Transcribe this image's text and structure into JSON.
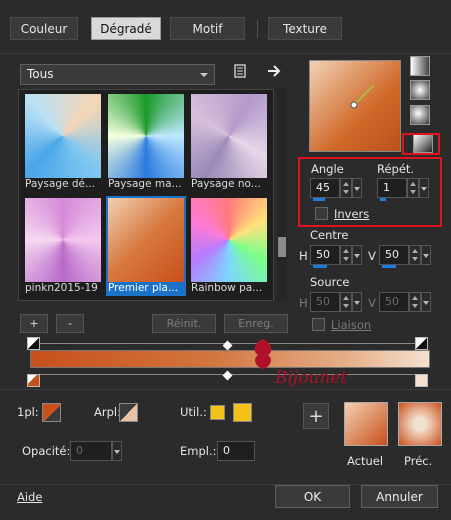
{
  "tabs": [
    "Couleur",
    "Dégradé",
    "Motif",
    "Texture"
  ],
  "active_tab": "Dégradé",
  "category_select": "Tous",
  "gallery": [
    {
      "caption": "Paysage dé..."
    },
    {
      "caption": "Paysage ma..."
    },
    {
      "caption": "Paysage no..."
    },
    {
      "caption": "pinkn2015-19"
    },
    {
      "caption": "Premier pla..."
    },
    {
      "caption": "Rainbow pa..."
    }
  ],
  "buttons": {
    "add": "+",
    "remove": "-",
    "reset": "Réinit.",
    "save": "Enreg.",
    "ok": "OK",
    "cancel": "Annuler",
    "help": "Aide",
    "add_swatch": "+"
  },
  "gradient": {
    "angle_label": "Angle",
    "angle_value": "45",
    "repeat_label": "Répét.",
    "repeat_value": "1",
    "invert_label": "Invers",
    "center_label": "Centre",
    "center_h_label": "H",
    "center_h": "50",
    "center_v_label": "V",
    "center_v": "50",
    "source_label": "Source",
    "source_h_label": "H",
    "source_h": "50",
    "source_v_label": "V",
    "source_v": "50",
    "link_label": "Liaison"
  },
  "editor": {
    "fg_label": "1pl:",
    "bg_label": "Arpl:",
    "user_label": "Util.:",
    "opacity_label": "Opacité:",
    "opacity_value": "0",
    "position_label": "Empl.:",
    "position_value": "0",
    "current_label": "Actuel",
    "previous_label": "Préc.",
    "watermark": "Bijounet"
  },
  "colors": {
    "accent": "#1a73c9",
    "highlight_box": "#e0141e",
    "gradient_start": "#c8501a",
    "gradient_end": "#f4e1d0",
    "user_color": "#f2c21a"
  }
}
